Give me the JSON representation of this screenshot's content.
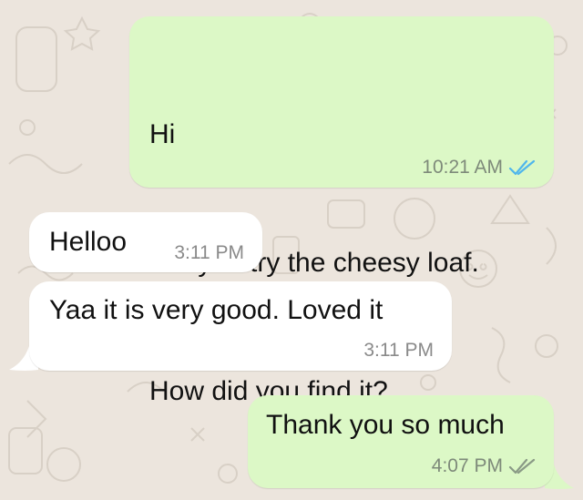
{
  "colors": {
    "background": "#ece5dd",
    "outgoing_bubble": "#dcf8c6",
    "incoming_bubble": "#ffffff",
    "read_tick": "#4fb6ec",
    "delivered_tick": "#8a9a86"
  },
  "messages": [
    {
      "direction": "outgoing",
      "lines": [
        "Hi",
        "Did you try the cheesy loaf.",
        "How did you find it?"
      ],
      "time": "10:21 AM",
      "status_icon": "double-check-read-icon"
    },
    {
      "direction": "incoming",
      "lines": [
        "Helloo"
      ],
      "time": "3:11 PM"
    },
    {
      "direction": "incoming",
      "lines": [
        "Yaa it is very good. Loved it"
      ],
      "time": "3:11 PM"
    },
    {
      "direction": "outgoing",
      "lines": [
        "Thank you so much"
      ],
      "time": "4:07 PM",
      "status_icon": "double-check-delivered-icon"
    }
  ]
}
